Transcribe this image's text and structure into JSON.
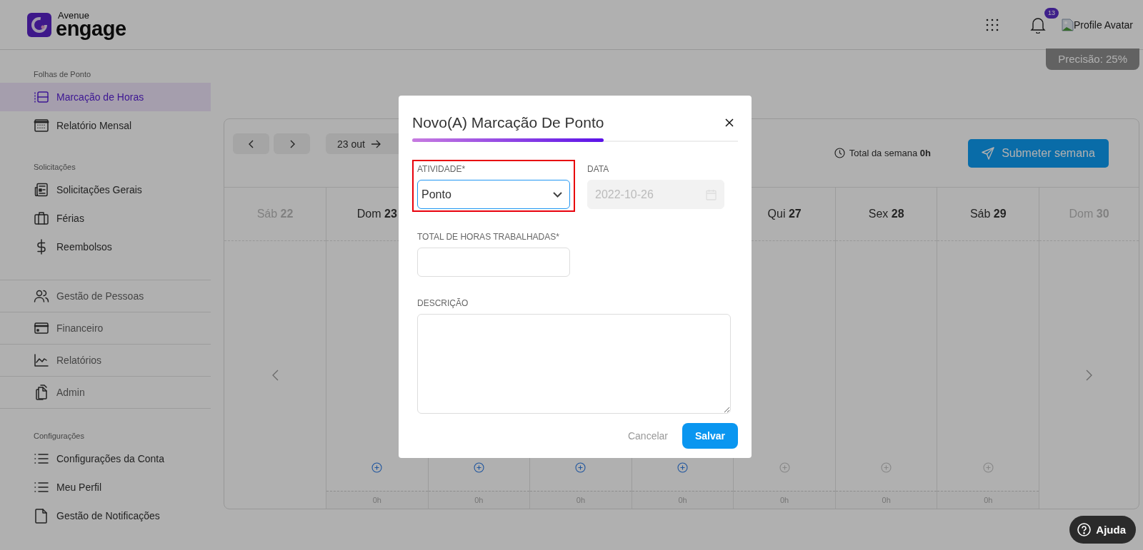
{
  "header": {
    "logo": {
      "top": "Avenue",
      "bottom": "engage"
    },
    "notifications": {
      "count": "13"
    },
    "avatar": {
      "alt": "Profile Avatar"
    }
  },
  "precision": "Precisão: 25%",
  "sidebar": {
    "sections": [
      {
        "kind": "list",
        "title": "Folhas de Ponto",
        "items": [
          {
            "label": "Marcação de Horas",
            "selected": true
          },
          {
            "label": "Relatório Mensal",
            "selected": false
          }
        ]
      },
      {
        "kind": "list",
        "title": "Solicitações",
        "items": [
          {
            "label": "Solicitações Gerais",
            "selected": false
          },
          {
            "label": "Férias",
            "selected": false
          },
          {
            "label": "Reembolsos",
            "selected": false
          }
        ]
      },
      {
        "kind": "divided",
        "items": [
          {
            "label": "Gestão de Pessoas",
            "selected": false
          },
          {
            "label": "Financeiro",
            "selected": false
          },
          {
            "label": "Relatórios",
            "selected": false
          },
          {
            "label": "Admin",
            "selected": false
          }
        ]
      },
      {
        "kind": "list",
        "title": "Configurações",
        "items": [
          {
            "label": "Configurações da Conta",
            "selected": false
          },
          {
            "label": "Meu Perfil",
            "selected": false
          },
          {
            "label": "Gestão de Notificações",
            "selected": false
          }
        ]
      }
    ]
  },
  "calendar": {
    "range_start": "23 out",
    "week_total_label": "Total da semana",
    "week_total": "0h",
    "submit": "Submeter semana",
    "previous_day": {
      "weekday": "Sáb",
      "number": "22"
    },
    "next_day": {
      "weekday": "Dom",
      "number": "30"
    },
    "days": [
      {
        "weekday": "Dom",
        "number": "23",
        "add_enabled": true,
        "hours": "0h"
      },
      {
        "add_enabled": true,
        "hours": "0h"
      },
      {
        "add_enabled": true,
        "hours": "0h"
      },
      {
        "add_enabled": true,
        "hours": "0h"
      },
      {
        "weekday": "Qui",
        "number": "27",
        "add_enabled": false,
        "hours": "0h"
      },
      {
        "weekday": "Sex",
        "number": "28",
        "add_enabled": false,
        "hours": "0h"
      },
      {
        "weekday": "Sáb",
        "number": "29",
        "add_enabled": false,
        "hours": "0h"
      }
    ]
  },
  "modal": {
    "title": "Novo(A) Marcação De Ponto",
    "fields": [
      {
        "kind": "select",
        "label": "ATIVIDADE*",
        "value": "Ponto",
        "highlighted": true,
        "disabled": false
      },
      {
        "kind": "date",
        "label": "DATA",
        "value": "2022-10-26",
        "highlighted": false,
        "disabled": true
      },
      {
        "kind": "text",
        "label": "TOTAL DE HORAS TRABALHADAS*",
        "highlighted": false,
        "disabled": false
      },
      {
        "kind": "textarea",
        "label": "DESCRIÇÃO",
        "highlighted": false,
        "disabled": false
      }
    ],
    "cancel": "Cancelar",
    "save": "Salvar"
  },
  "help": "Ajuda"
}
